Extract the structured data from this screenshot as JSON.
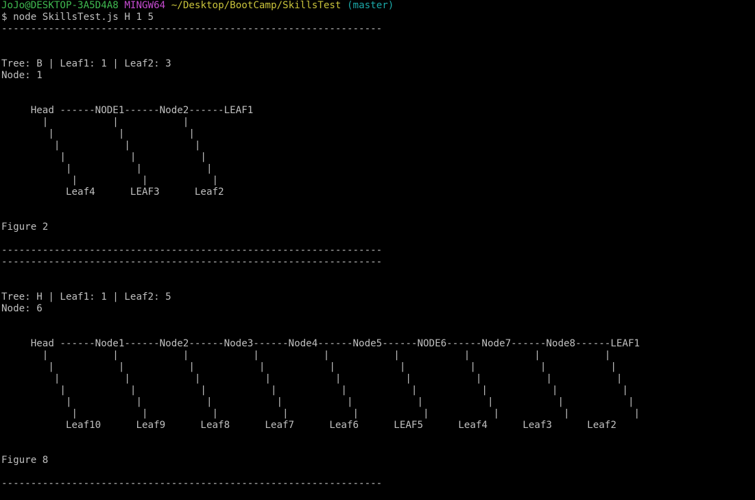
{
  "colors": {
    "background": "#000000",
    "foreground": "#c0c0c0",
    "user_host": "#3fb950",
    "shell": "#c64bd1",
    "path": "#c9c33b",
    "branch": "#1ba8a8"
  },
  "prompt": {
    "user_host": "JoJo@DESKTOP-3A5D4A8",
    "shell": "MINGW64",
    "path": "~/Desktop/BootCamp/SkillsTest",
    "branch": "(master)",
    "symbol": "$",
    "command": "node SkillsTest.js H 1 5"
  },
  "output_lines": [
    "-----------------------------------------------------------------",
    "",
    "",
    "Tree: B | Leaf1: 1 | Leaf2: 3",
    "Node: 1",
    "",
    "",
    "     Head ------NODE1------Node2------LEAF1",
    "       |           |           |",
    "        |           |           |",
    "         |           |           |",
    "          |           |           |",
    "           |           |           |",
    "            |           |           |",
    "           Leaf4      LEAF3      Leaf2",
    "",
    "",
    "Figure 2",
    "",
    "-----------------------------------------------------------------",
    "-----------------------------------------------------------------",
    "",
    "",
    "Tree: H | Leaf1: 1 | Leaf2: 5",
    "Node: 6",
    "",
    "",
    "     Head ------Node1------Node2------Node3------Node4------Node5------NODE6------Node7------Node8------LEAF1",
    "       |           |           |           |           |           |           |           |           |",
    "        |           |           |           |           |           |           |           |           |",
    "         |           |           |           |           |           |           |           |           |",
    "          |           |           |           |           |           |           |           |           |",
    "           |           |           |           |           |           |           |           |           |",
    "            |           |           |           |           |           |           |           |           |",
    "           Leaf10      Leaf9      Leaf8      Leaf7      Leaf6      LEAF5      Leaf4      Leaf3      Leaf2",
    "",
    "",
    "Figure 8",
    "",
    "-----------------------------------------------------------------"
  ]
}
